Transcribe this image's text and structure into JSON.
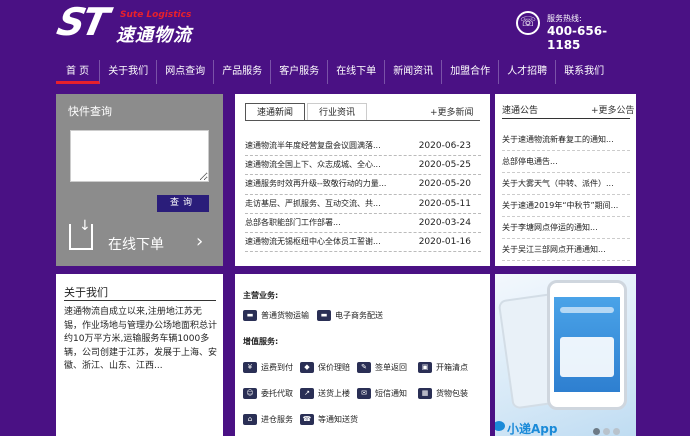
{
  "header": {
    "logo_letters": "ST",
    "logo_en": "Sute Logistics",
    "logo_cn": "速通物流",
    "hotline_label": "服务热线:",
    "hotline_number": "400-656-1185"
  },
  "nav": [
    "首 页",
    "关于我们",
    "网点查询",
    "产品服务",
    "客户服务",
    "在线下单",
    "新闻资讯",
    "加盟合作",
    "人才招聘",
    "联系我们"
  ],
  "quick": {
    "title": "快件查询",
    "textarea_value": "",
    "button": "查询",
    "order_label": "在线下单"
  },
  "news": {
    "tabs": [
      "速通新闻",
      "行业资讯"
    ],
    "more": "+更多新闻",
    "items": [
      {
        "title": "速通物流半年度经营复盘会议圆满落...",
        "date": "2020-06-23"
      },
      {
        "title": "速通物流全国上下、众志成城、全心...",
        "date": "2020-05-25"
      },
      {
        "title": "速通服务时效再升级--致敬行动的力量...",
        "date": "2020-05-20"
      },
      {
        "title": "走访基层、严抓服务、互动交流、共...",
        "date": "2020-05-11"
      },
      {
        "title": "总部各职能部门工作部署...",
        "date": "2020-03-24"
      },
      {
        "title": "速通物流无锡枢纽中心全体员工誓谢...",
        "date": "2020-01-16"
      }
    ]
  },
  "notice": {
    "title": "速通公告",
    "more": "+更多公告",
    "items": [
      "关于速通物流新春复工的通知...",
      "总部停电通告...",
      "关于大雾天气（中转、派件）...",
      "关于速通2019年“中秋节”期间...",
      "关于李塘网点停运的通知...",
      "关于吴江三部网点开通通知..."
    ]
  },
  "about": {
    "title": "关于我们",
    "text": "速通物流自成立以来,注册地江苏无锡，作业场地与管理办公场地面积总计约10万平方米,运输服务车辆1000多辆，公司创建于江苏，发展于上海、安徽、浙江、山东、江西..."
  },
  "services": {
    "main_title": "主营业务:",
    "main": [
      {
        "label": "普通货物运输",
        "icon": "truck-icon"
      },
      {
        "label": "电子商务配送",
        "icon": "delivery-truck-icon"
      }
    ],
    "extra_title": "增值服务:",
    "extra": [
      {
        "label": "运费到付",
        "icon": "truck-pay-icon"
      },
      {
        "label": "保价理赔",
        "icon": "insurance-icon"
      },
      {
        "label": "签单返回",
        "icon": "receipt-icon"
      },
      {
        "label": "开箱清点",
        "icon": "box-open-icon"
      },
      {
        "label": "委托代取",
        "icon": "person-pickup-icon"
      },
      {
        "label": "送货上楼",
        "icon": "stairs-icon"
      },
      {
        "label": "短信通知",
        "icon": "sms-icon"
      },
      {
        "label": "货物包装",
        "icon": "package-icon"
      },
      {
        "label": "进仓服务",
        "icon": "warehouse-icon"
      },
      {
        "label": "等通知送货",
        "icon": "phone-notify-icon"
      }
    ]
  },
  "app": {
    "name": "小递App"
  }
}
